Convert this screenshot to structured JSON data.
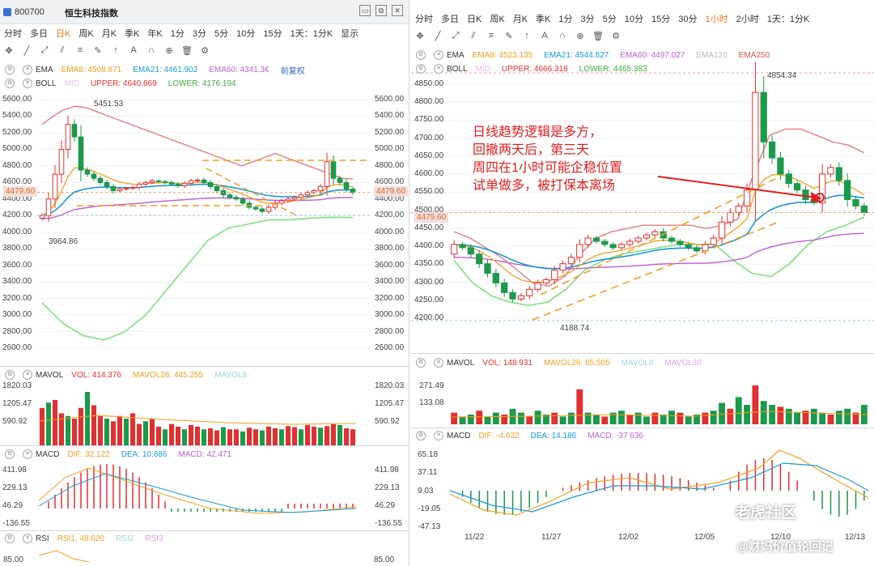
{
  "left": {
    "code": "800700",
    "name": "恒生科技指数",
    "timeframes": [
      "分时",
      "多日",
      "日K",
      "周K",
      "月K",
      "季K",
      "年K",
      "1分",
      "3分",
      "5分",
      "10分",
      "15分",
      "1天：1分K",
      "显示"
    ],
    "active_tf": 2,
    "ema": {
      "label": "EMA",
      "ema8": "EMA8: 4508.871",
      "ema21": "EMA21: 4461.902",
      "ema60": "EMA60: 4341.3€",
      "fq": "前复权"
    },
    "boll": {
      "label": "BOLL",
      "mid": "MID",
      "upper": "UPPER: 4640.869",
      "lower": "LOWER: 4176.194"
    },
    "price_axis": [
      "5600.00",
      "5400.00",
      "5200.00",
      "5000.00",
      "4800.00",
      "4600.00",
      "4400.00",
      "4200.00",
      "4000.00",
      "3800.00",
      "3600.00",
      "3400.00",
      "3200.00",
      "3000.00",
      "2800.00",
      "2600.00"
    ],
    "current_price": "4479.60",
    "high_label": "5451.53",
    "low_label": "3964.86",
    "mavol": {
      "label": "MAVOL",
      "vol": "VOL: 414.376",
      "mavol26": "MAVOL26: 445.255",
      "mavol8": "MAVOL8"
    },
    "vol_axis": [
      "1820.03",
      "1205.47",
      "590.92"
    ],
    "macd": {
      "label": "MACD",
      "dif": "DIF: 32.122",
      "dea": "DEA: 10.886",
      "macd": "MACD: 42.471"
    },
    "macd_axis": [
      "411.98",
      "229.13",
      "46.29",
      "-136.55"
    ],
    "rsi": {
      "label": "RSI",
      "rsi1": "RSI1: 48.620",
      "rsi2": "RSI2",
      "rsi3": "RSI3"
    },
    "rsi_axis": [
      "85.00"
    ]
  },
  "right": {
    "timeframes": [
      "分时",
      "多日",
      "日K",
      "周K",
      "月K",
      "季K",
      "1分",
      "3分",
      "5分",
      "10分",
      "15分",
      "30分",
      "1小时",
      "2小时",
      "1天：1分K"
    ],
    "active_tf": 12,
    "ema": {
      "label": "EMA",
      "ema8": "EMA8: 4523.135",
      "ema21": "EMA21: 4544.827",
      "ema60": "EMA60: 4497.027",
      "ema120": "EMA120",
      "ema250": "EMA250"
    },
    "boll": {
      "label": "BOLL",
      "mid": "MID",
      "upper": "UPPER: 4666.318",
      "lower": "LOWER: 4465.383"
    },
    "price_axis": [
      "4850.00",
      "4800.00",
      "4750.00",
      "4700.00",
      "4650.00",
      "4600.00",
      "4550.00",
      "4500.00",
      "4450.00",
      "4400.00",
      "4350.00",
      "4300.00",
      "4250.00",
      "4200.00"
    ],
    "current_price": "4479.60",
    "high_label": "4854.34",
    "low_label": "4188.74",
    "annotation": [
      "日线趋势逻辑是多方，",
      "回撤两天后，第三天",
      "周四在1小时可能企稳位置",
      "试单做多，被打保本离场"
    ],
    "mavol": {
      "label": "MAVOL",
      "vol": "VOL: 148.931",
      "mavol26": "MAVOL26: 85.505",
      "mavol8": "MAVOL8",
      "mavol30": "MAVOL30"
    },
    "vol_axis": [
      "271.49",
      "133.08"
    ],
    "macd": {
      "label": "MACD",
      "dif": "DIF: -4.632",
      "dea": "DEA: 14.186",
      "macd": "MACD: -37.636"
    },
    "macd_axis": [
      "65.18",
      "37.11",
      "9.03",
      "-19.05",
      "-47.13"
    ],
    "dates": [
      "11/22",
      "11/27",
      "12/02",
      "12/05",
      "12/10",
      "12/13"
    ]
  },
  "watermark": {
    "line1": "老虎社区",
    "line2": "@财妈价值轮回记"
  },
  "colors": {
    "up": "#e03030",
    "down": "#1a9a4a",
    "ema8": "#f0a020",
    "ema21": "#1a9ad8",
    "ema60": "#c060d0",
    "upper": "#e08080",
    "lower": "#80e080",
    "active": "#e87a1a"
  },
  "chart_data": [
    {
      "type": "candlestick",
      "title": "恒生科技指数 日K",
      "ylim": [
        2600,
        5600
      ],
      "series": [
        {
          "name": "close",
          "values": [
            4200,
            4400,
            4700,
            5000,
            5300,
            5150,
            4750,
            4700,
            4650,
            4600,
            4550,
            4500,
            4520,
            4530,
            4540,
            4580,
            4600,
            4620,
            4610,
            4600,
            4580,
            4560,
            4590,
            4620,
            4630,
            4600,
            4550,
            4500,
            4450,
            4420,
            4400,
            4350,
            4300,
            4280,
            4250,
            4300,
            4350,
            4380,
            4400,
            4420,
            4450,
            4480,
            4500,
            4550,
            4850,
            4650,
            4600,
            4520,
            4479.6
          ]
        },
        {
          "name": "UPPER",
          "values": [
            5300,
            5400,
            5480,
            5520,
            5500,
            5450,
            5400,
            5350,
            5300,
            5250,
            5200,
            5150,
            5100,
            5050,
            5000,
            4950,
            4900,
            4850,
            4800,
            4850,
            4900,
            4950,
            4900,
            4850,
            4800,
            4750,
            4700,
            4650,
            4640.9
          ]
        },
        {
          "name": "LOWER",
          "values": [
            3150,
            2900,
            2750,
            2700,
            2800,
            3000,
            3300,
            3600,
            3900,
            4050,
            4100,
            4150,
            4150,
            4170,
            4180,
            4176.2
          ]
        }
      ]
    },
    {
      "type": "candlestick",
      "title": "恒生科技指数 1小时",
      "ylim": [
        4150,
        4880
      ],
      "series": [
        {
          "name": "close",
          "values": [
            4380,
            4370,
            4350,
            4320,
            4290,
            4260,
            4230,
            4210,
            4220,
            4240,
            4260,
            4270,
            4300,
            4320,
            4340,
            4380,
            4400,
            4390,
            4380,
            4370,
            4380,
            4390,
            4400,
            4410,
            4420,
            4400,
            4390,
            4380,
            4370,
            4360,
            4380,
            4400,
            4450,
            4480,
            4500,
            4550,
            4854.34,
            4700,
            4650,
            4600,
            4570,
            4550,
            4520,
            4510,
            4600,
            4620,
            4580,
            4520,
            4500,
            4479.6
          ]
        },
        {
          "name": "UPPER",
          "values": [
            4420,
            4400,
            4370,
            4340,
            4300,
            4260,
            4250,
            4280,
            4350,
            4400,
            4420,
            4430,
            4440,
            4440,
            4440,
            4440,
            4430,
            4440,
            4460,
            4600,
            4720,
            4740,
            4740,
            4720,
            4700,
            4690,
            4666.3
          ]
        },
        {
          "name": "LOWER",
          "values": [
            4330,
            4260,
            4220,
            4200,
            4190,
            4200,
            4240,
            4300,
            4330,
            4350,
            4360,
            4370,
            4380,
            4380,
            4380,
            4330,
            4290,
            4280,
            4320,
            4380,
            4420,
            4440,
            4465.4
          ]
        }
      ]
    }
  ]
}
